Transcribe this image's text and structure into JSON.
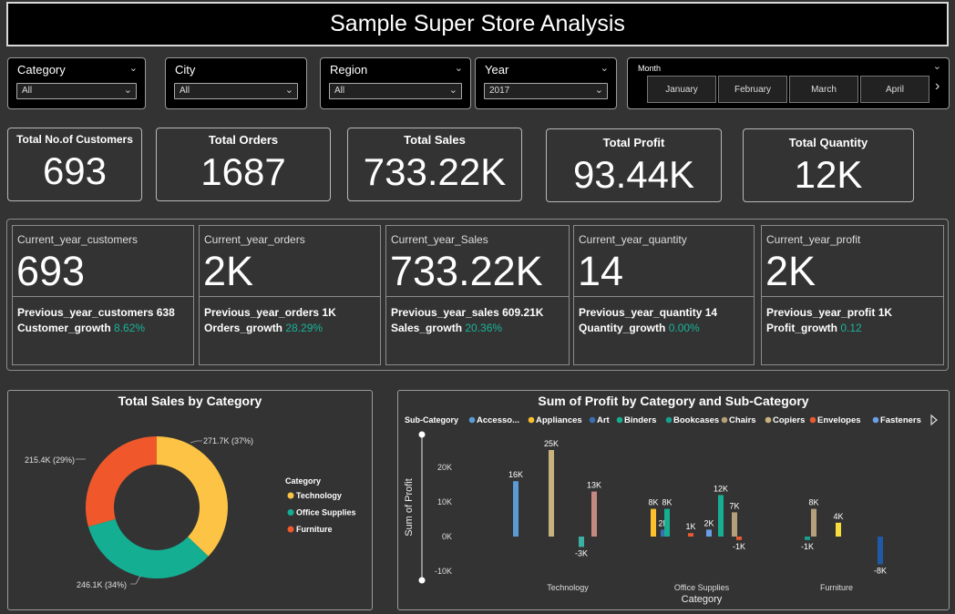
{
  "title": "Sample Super Store Analysis",
  "slicers": [
    {
      "label": "Category",
      "value": "All"
    },
    {
      "label": "City",
      "value": "All"
    },
    {
      "label": "Region",
      "value": "All"
    },
    {
      "label": "Year",
      "value": "2017"
    }
  ],
  "month_slicer": {
    "label": "Month",
    "options": [
      "January",
      "February",
      "March",
      "April"
    ]
  },
  "kpis": [
    {
      "label": "Total No.of Customers",
      "value": "693"
    },
    {
      "label": "Total Orders",
      "value": "1687"
    },
    {
      "label": "Total Sales",
      "value": "733.22K"
    },
    {
      "label": "Total Profit",
      "value": "93.44K"
    },
    {
      "label": "Total Quantity",
      "value": "12K"
    }
  ],
  "growth_cards": [
    {
      "label": "Current_year_customers",
      "value": "693",
      "prev": "Previous_year_customers 638",
      "growth_label": "Customer_growth",
      "growth": "8.62%"
    },
    {
      "label": "Current_year_orders",
      "value": "2K",
      "prev": "Previous_year_orders 1K",
      "growth_label": "Orders_growth",
      "growth": "28.29%"
    },
    {
      "label": "Current_year_Sales",
      "value": "733.22K",
      "prev": "Previous_year_sales 609.21K",
      "growth_label": "Sales_growth",
      "growth": "20.36%"
    },
    {
      "label": "Current_year_quantity",
      "value": "14",
      "prev": "Previous_year_quantity 14",
      "growth_label": "Quantity_growth",
      "growth": "0.00%"
    },
    {
      "label": "Current_year_profit",
      "value": "2K",
      "prev": "Previous_year_profit 1K",
      "growth_label": "Profit_growth",
      "growth": "0.12"
    }
  ],
  "colors": {
    "growth": "#19b49a",
    "technology": "#fcc344",
    "office_supplies": "#14ae93",
    "furniture": "#f0582c"
  },
  "chart_data": [
    {
      "type": "pie",
      "title": "Total Sales by Category",
      "legend_title": "Category",
      "legend_position": "right",
      "categories": [
        "Technology",
        "Office Supplies",
        "Furniture"
      ],
      "values": [
        271.7,
        246.1,
        215.4
      ],
      "labels": [
        "271.7K (37%)",
        "246.1K (34%)",
        "215.4K (29%)"
      ],
      "colors": [
        "#fcc344",
        "#14ae93",
        "#f0582c"
      ]
    },
    {
      "type": "bar",
      "title": "Sum of Profit by Category and Sub-Category",
      "xlabel": "Category",
      "ylabel": "Sum of Profit",
      "legend_title": "Sub-Category",
      "legend_position": "top",
      "legend": [
        {
          "name": "Accesso...",
          "color": "#5b9bd5"
        },
        {
          "name": "Appliances",
          "color": "#fcc02d"
        },
        {
          "name": "Art",
          "color": "#3a6fb5"
        },
        {
          "name": "Binders",
          "color": "#17ad91"
        },
        {
          "name": "Bookcases",
          "color": "#15a090"
        },
        {
          "name": "Chairs",
          "color": "#b4a07a"
        },
        {
          "name": "Copiers",
          "color": "#c9b27d"
        },
        {
          "name": "Envelopes",
          "color": "#e85a30"
        },
        {
          "name": "Fasteners",
          "color": "#6c9ee6"
        }
      ],
      "yticks": [
        "20K",
        "10K",
        "0K",
        "-10K"
      ],
      "ylim": [
        -10000,
        25000
      ],
      "groups": [
        {
          "category": "Technology",
          "bars": [
            {
              "value": 16000,
              "label": "16K",
              "color": "#5b9bd5"
            },
            {
              "value": 25000,
              "label": "25K",
              "color": "#c9b27d"
            },
            {
              "value": -3000,
              "label": "-3K",
              "color": "#3bb0a3"
            },
            {
              "value": 13000,
              "label": "13K",
              "color": "#c48a80"
            }
          ]
        },
        {
          "category": "Office Supplies",
          "bars": [
            {
              "value": 8000,
              "label": "8K",
              "color": "#fcc02d"
            },
            {
              "value": 2000,
              "label": "2K",
              "color": "#3a6fb5"
            },
            {
              "value": 8000,
              "label": "8K",
              "color": "#17ad91"
            },
            {
              "value": 1000,
              "label": "1K",
              "color": "#e85a30"
            },
            {
              "value": 2000,
              "label": "2K",
              "color": "#6c9ee6"
            },
            {
              "value": 12000,
              "label": "12K",
              "color": "#17ad91"
            },
            {
              "value": 7000,
              "label": "7K",
              "color": "#b4a07a"
            },
            {
              "value": -1000,
              "label": "-1K",
              "color": "#e85a30"
            }
          ]
        },
        {
          "category": "Furniture",
          "bars": [
            {
              "value": -1000,
              "label": "-1K",
              "color": "#15a090"
            },
            {
              "value": 8000,
              "label": "8K",
              "color": "#b4a07a"
            },
            {
              "value": 4000,
              "label": "4K",
              "color": "#f7de3e"
            },
            {
              "value": -8000,
              "label": "-8K",
              "color": "#1f5aa6"
            }
          ]
        }
      ]
    }
  ]
}
